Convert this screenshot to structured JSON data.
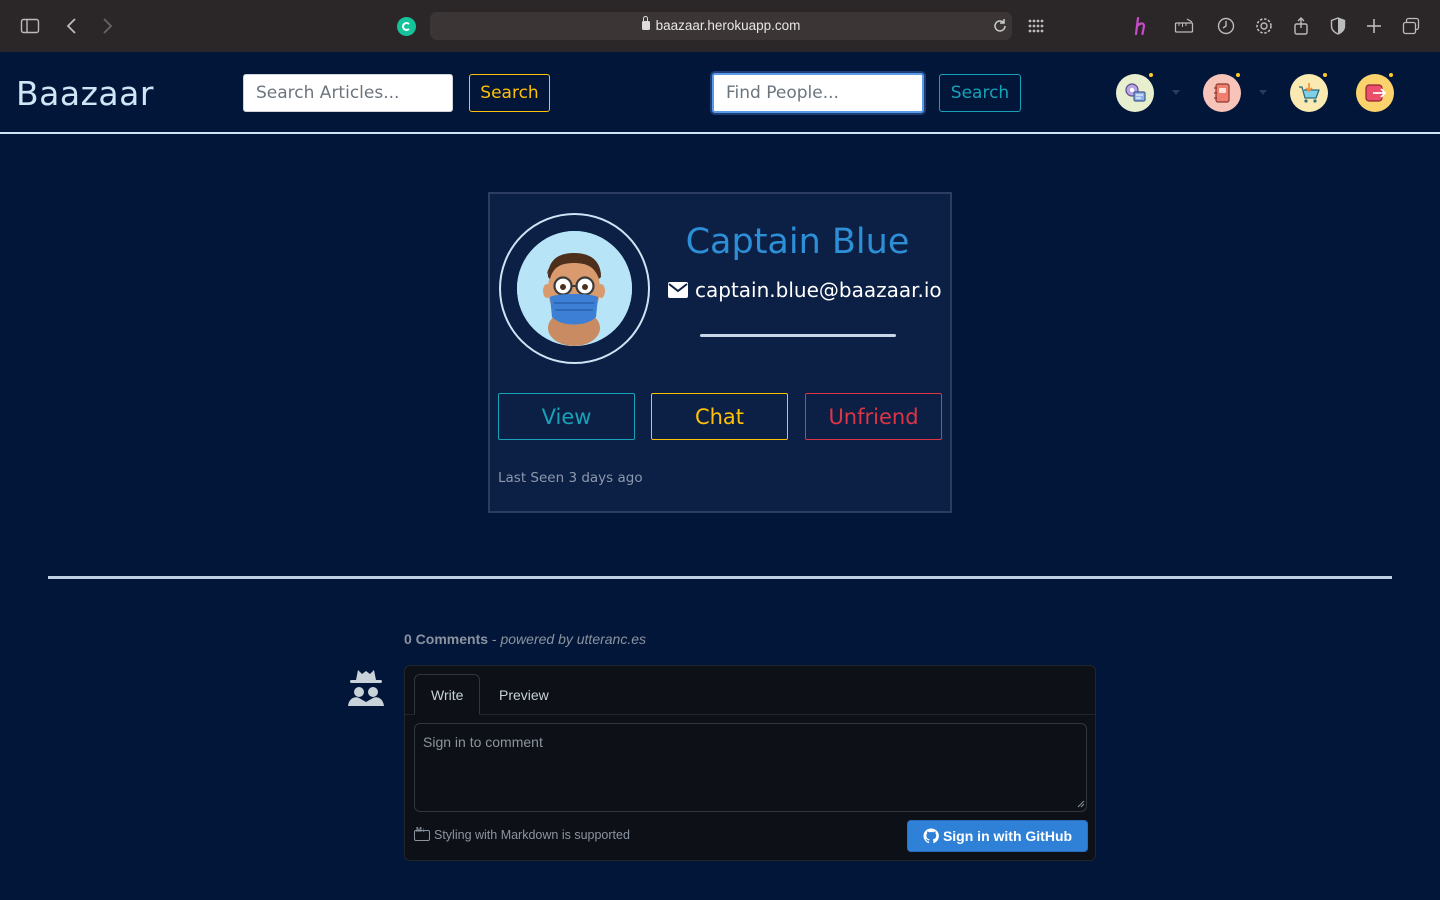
{
  "browser": {
    "url": "baazaar.herokuapp.com"
  },
  "navbar": {
    "brand": "Baazaar",
    "article_search_placeholder": "Search Articles...",
    "article_search_button": "Search",
    "people_search_placeholder": "Find People...",
    "people_search_button": "Search"
  },
  "profile": {
    "name": "Captain Blue",
    "email": "captain.blue@baazaar.io",
    "buttons": {
      "view": "View",
      "chat": "Chat",
      "unfriend": "Unfriend"
    },
    "last_seen": "Last Seen 3 days ago"
  },
  "comments": {
    "count_label": "0 Comments",
    "powered_by": "powered by utteranc.es",
    "tab_write": "Write",
    "tab_preview": "Preview",
    "placeholder": "Sign in to comment",
    "markdown_note": "Styling with Markdown is supported",
    "signin_button": "Sign in with GitHub"
  },
  "colors": {
    "page_bg": "#02163a",
    "card_bg": "#0c1f45",
    "accent_name": "#2d8fd6",
    "warning": "#ffc107",
    "info": "#17a2b8",
    "danger": "#dc3545",
    "github_button": "#2f81d7"
  }
}
